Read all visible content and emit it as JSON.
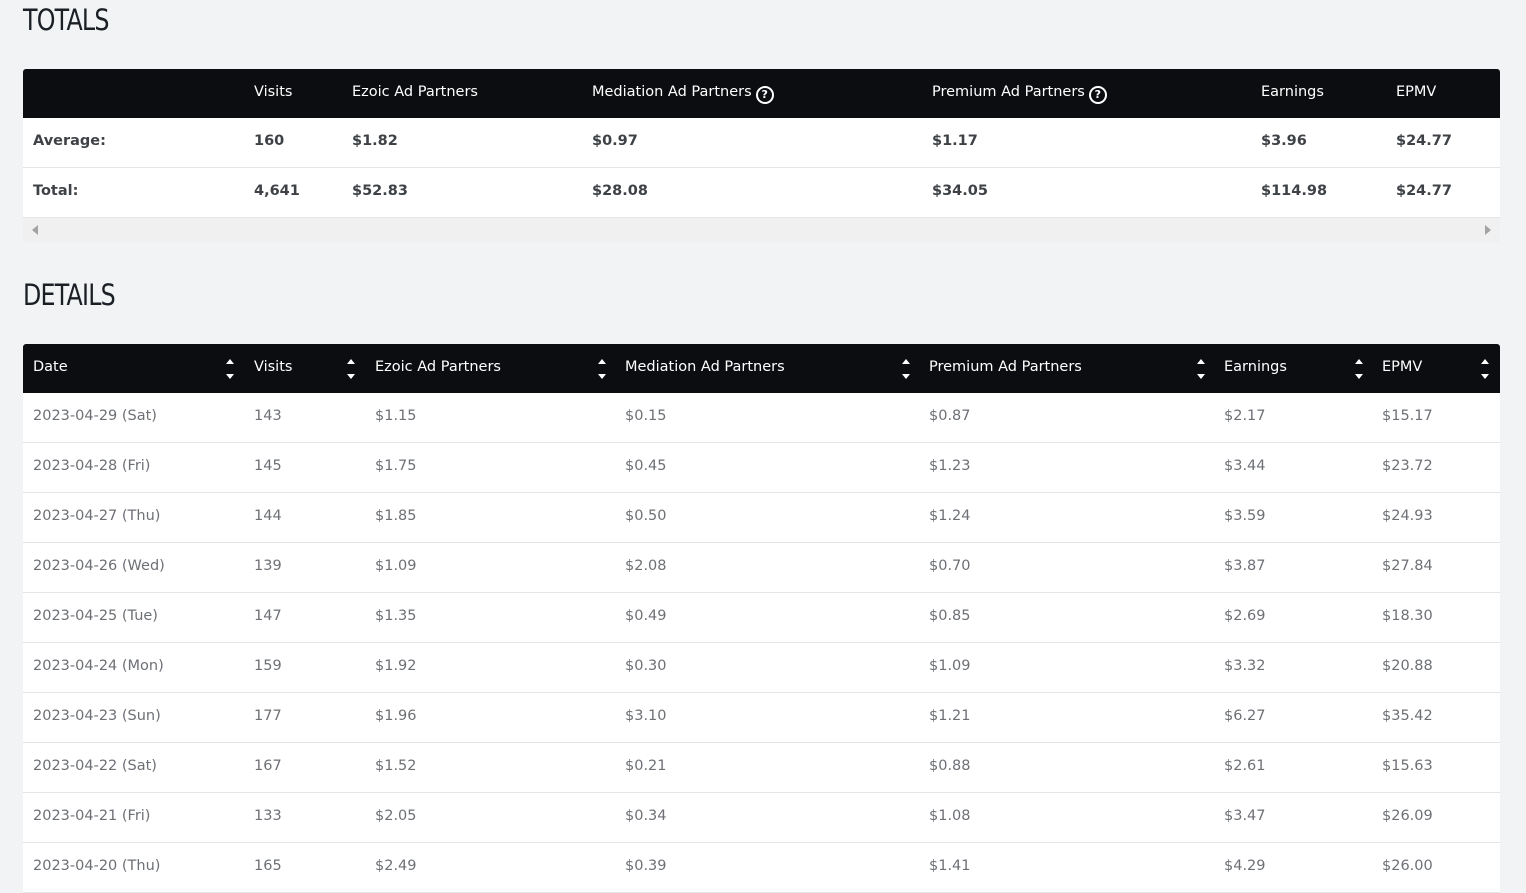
{
  "totals": {
    "title": "TOTALS",
    "headers": [
      "",
      "Visits",
      "Ezoic Ad Partners",
      "Mediation Ad Partners",
      "Premium Ad Partners",
      "Earnings",
      "EPMV"
    ],
    "help_icon": "?",
    "rows": [
      [
        "Average:",
        "160",
        "$1.82",
        "$0.97",
        "$1.17",
        "$3.96",
        "$24.77"
      ],
      [
        "Total:",
        "4,641",
        "$52.83",
        "$28.08",
        "$34.05",
        "$114.98",
        "$24.77"
      ]
    ]
  },
  "details": {
    "title": "DETAILS",
    "headers": [
      "Date",
      "Visits",
      "Ezoic Ad Partners",
      "Mediation Ad Partners",
      "Premium Ad Partners",
      "Earnings",
      "EPMV"
    ],
    "rows": [
      [
        "2023-04-29 (Sat)",
        "143",
        "$1.15",
        "$0.15",
        "$0.87",
        "$2.17",
        "$15.17"
      ],
      [
        "2023-04-28 (Fri)",
        "145",
        "$1.75",
        "$0.45",
        "$1.23",
        "$3.44",
        "$23.72"
      ],
      [
        "2023-04-27 (Thu)",
        "144",
        "$1.85",
        "$0.50",
        "$1.24",
        "$3.59",
        "$24.93"
      ],
      [
        "2023-04-26 (Wed)",
        "139",
        "$1.09",
        "$2.08",
        "$0.70",
        "$3.87",
        "$27.84"
      ],
      [
        "2023-04-25 (Tue)",
        "147",
        "$1.35",
        "$0.49",
        "$0.85",
        "$2.69",
        "$18.30"
      ],
      [
        "2023-04-24 (Mon)",
        "159",
        "$1.92",
        "$0.30",
        "$1.09",
        "$3.32",
        "$20.88"
      ],
      [
        "2023-04-23 (Sun)",
        "177",
        "$1.96",
        "$3.10",
        "$1.21",
        "$6.27",
        "$35.42"
      ],
      [
        "2023-04-22 (Sat)",
        "167",
        "$1.52",
        "$0.21",
        "$0.88",
        "$2.61",
        "$15.63"
      ],
      [
        "2023-04-21 (Fri)",
        "133",
        "$2.05",
        "$0.34",
        "$1.08",
        "$3.47",
        "$26.09"
      ],
      [
        "2023-04-20 (Thu)",
        "165",
        "$2.49",
        "$0.39",
        "$1.41",
        "$4.29",
        "$26.00"
      ]
    ]
  },
  "colors": {
    "header_bg": "#0b0d10",
    "page_bg": "#f2f3f4",
    "row_bg": "#ffffff",
    "row_border": "#e4e5e7"
  }
}
